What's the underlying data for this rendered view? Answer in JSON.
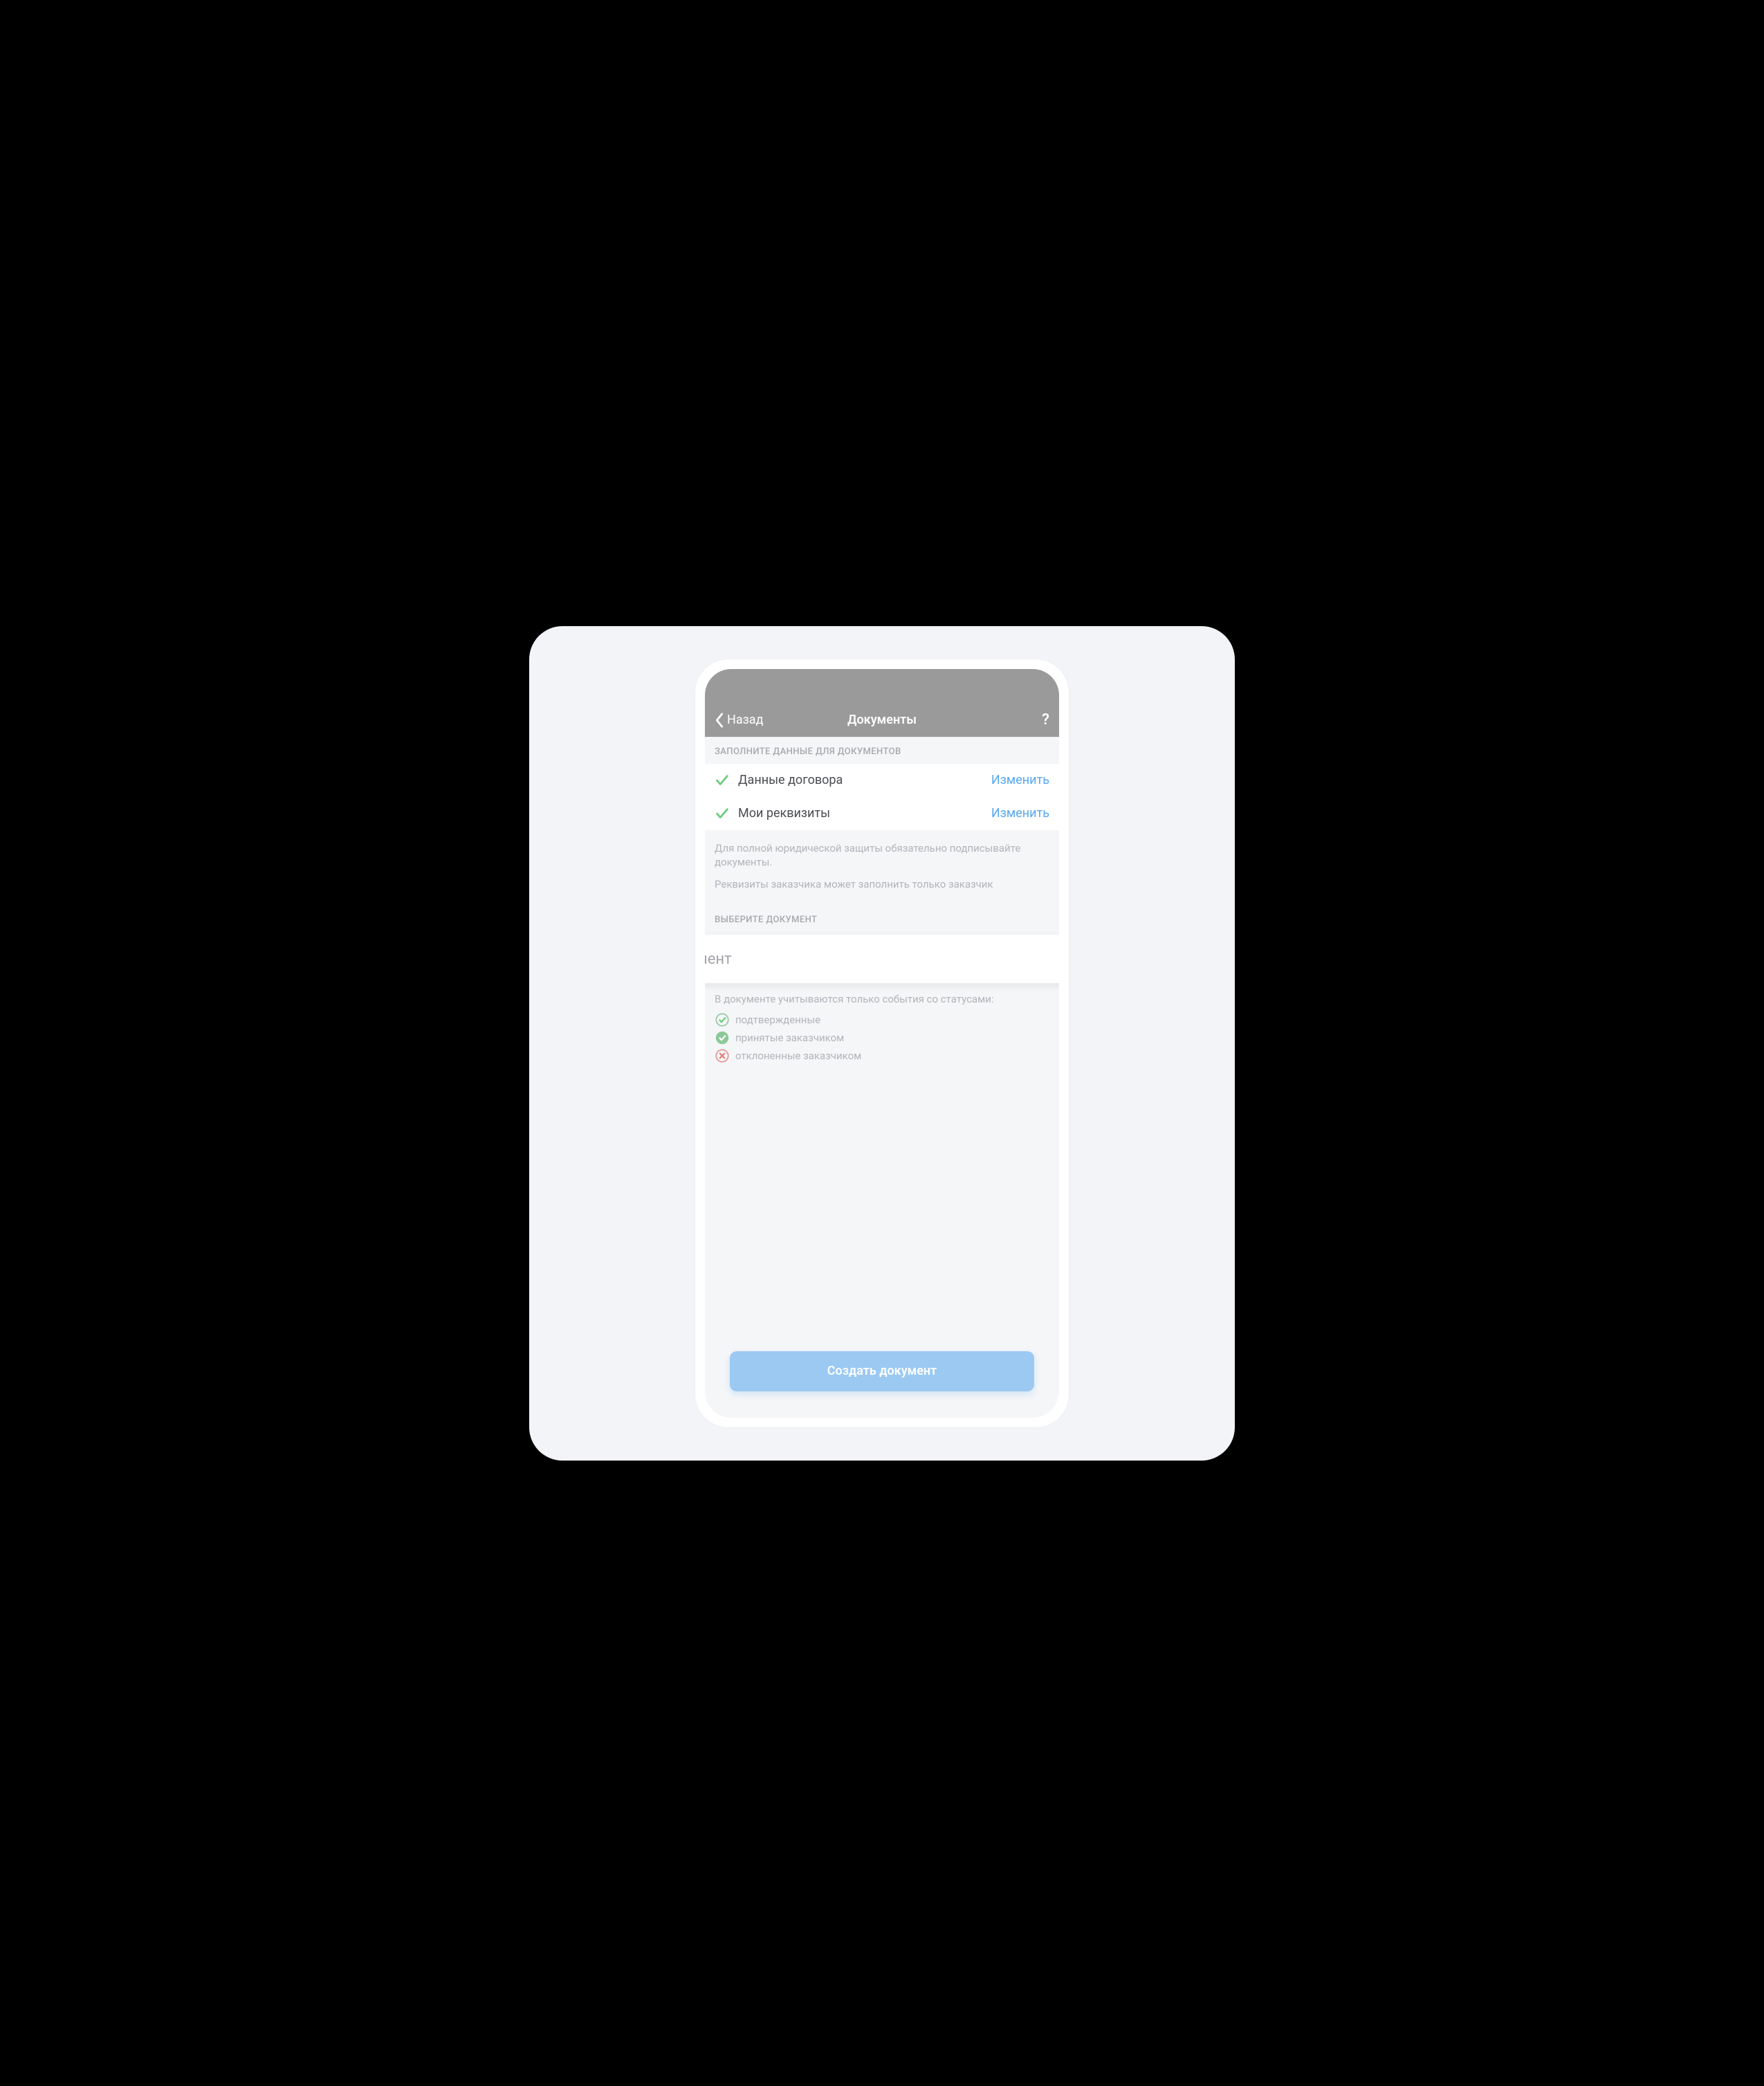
{
  "nav": {
    "back": "Назад",
    "title": "Документы"
  },
  "section_fill": "ЗАПОЛНИТЕ ДАННЫЕ ДЛЯ ДОКУМЕНТОВ",
  "items": {
    "contract": {
      "label": "Данные договора",
      "action": "Изменить"
    },
    "requisites": {
      "label": "Мои реквизиты",
      "action": "Изменить"
    }
  },
  "info": {
    "line1": "Для полной юридической защиты обязательно подписывайте документы.",
    "line2": "Реквизиты заказчика может заполнить только заказчик"
  },
  "section_select": "ВЫБЕРИТЕ ДОКУМЕНТ",
  "select_placeholder": "Документ",
  "status": {
    "intro": "В документе учитываются только события со статусами:",
    "confirmed": "подтвержденные",
    "accepted": "принятые заказчиком",
    "rejected": "отклоненные заказчиком"
  },
  "create": "Создать документ"
}
